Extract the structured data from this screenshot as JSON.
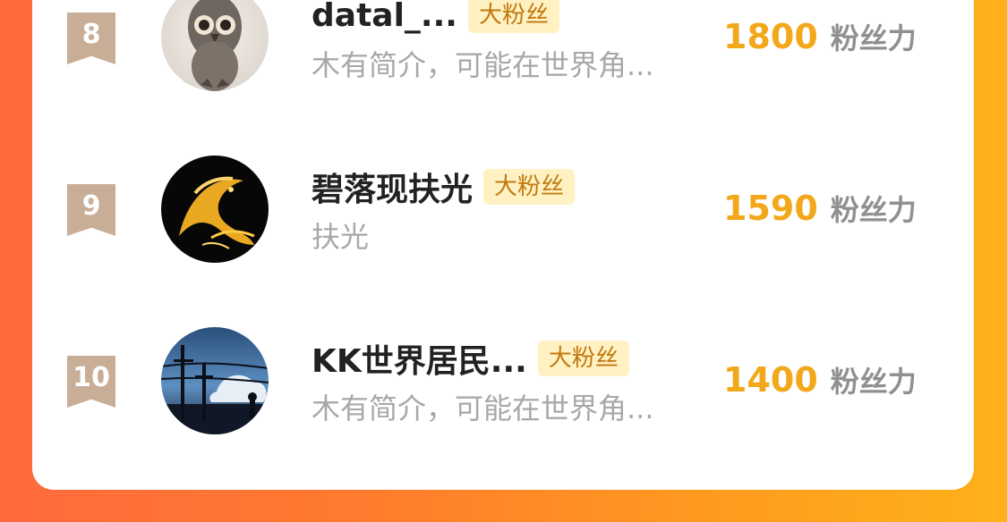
{
  "colors": {
    "background_gradient_start": "#ff6a3d",
    "background_gradient_end": "#ffb11a",
    "score": "#f2a81a",
    "badge_bg": "#fff1c2",
    "badge_text": "#c07a10",
    "rank_ribbon": "#c9ae97"
  },
  "leaderboard": {
    "rows": [
      {
        "rank": "8",
        "name": "datal_...",
        "badge": "大粉丝",
        "description": "木有简介，可能在世界角...",
        "score": "1800",
        "score_unit": "粉丝力",
        "avatar_icon": "owl-avatar"
      },
      {
        "rank": "9",
        "name": "碧落现扶光",
        "badge": "大粉丝",
        "description": "扶光",
        "score": "1590",
        "score_unit": "粉丝力",
        "avatar_icon": "dragon-avatar"
      },
      {
        "rank": "10",
        "name": "KK世界居民...",
        "badge": "大粉丝",
        "description": "木有简介，可能在世界角...",
        "score": "1400",
        "score_unit": "粉丝力",
        "avatar_icon": "sky-power-lines-avatar"
      }
    ]
  }
}
